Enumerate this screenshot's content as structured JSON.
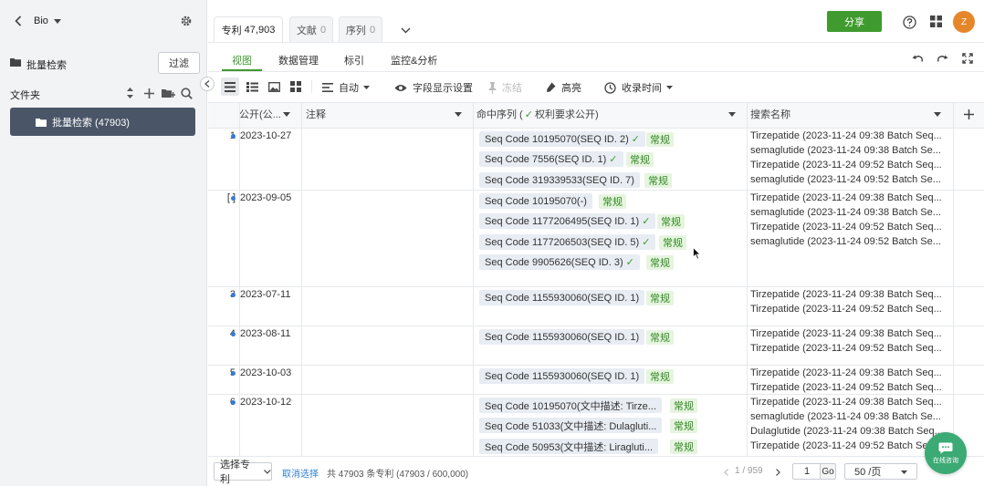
{
  "sidebar": {
    "title": "Bio",
    "search_label": "批量检索",
    "filter_button": "过滤",
    "folder_label": "文件夹",
    "folder_item": "批量检索 (47903)"
  },
  "tabs": [
    {
      "label": "专利",
      "count": "47,903"
    },
    {
      "label": "文献",
      "count": "0"
    },
    {
      "label": "序列",
      "count": "0"
    }
  ],
  "header": {
    "share": "分享",
    "avatar": "Z"
  },
  "subtabs": [
    "视图",
    "数据管理",
    "标引",
    "监控&分析"
  ],
  "toolbar": {
    "auto": "自动",
    "fields": "字段显示设置",
    "freeze": "冻结",
    "highlight": "高亮",
    "collect_time": "收录时间"
  },
  "columns": {
    "pub": "公开(公...",
    "note": "注释",
    "hits": "命中序列 (",
    "hits_tail": " 权利要求公开)",
    "search": "搜索名称"
  },
  "rows": [
    {
      "num": "1",
      "date": "2023-10-27"
    },
    {
      "num": "[ ]",
      "date": "2023-09-05"
    },
    {
      "num": "3",
      "date": "2023-07-11"
    },
    {
      "num": "4",
      "date": "2023-08-11"
    },
    {
      "num": "5",
      "date": "2023-10-03"
    },
    {
      "num": "6",
      "date": "2023-10-12"
    }
  ],
  "seqs": [
    {
      "text": "Seq Code 10195070(SEQ ID. 2)",
      "check": "✓",
      "badge": "常规"
    },
    {
      "text": "Seq Code 7556(SEQ ID. 1)",
      "check": "✓",
      "badge": "常规"
    },
    {
      "text": "Seq Code 319339533(SEQ ID. 7)",
      "check": "",
      "badge": "常规"
    },
    {
      "text": "Seq Code 10195070(-)",
      "check": "",
      "badge": "常规"
    },
    {
      "text": "Seq Code 1177206495(SEQ ID. 1)",
      "check": "✓",
      "badge": "常规"
    },
    {
      "text": "Seq Code 1177206503(SEQ ID. 5)",
      "check": "✓",
      "badge": "常规"
    },
    {
      "text": "Seq Code 9905626(SEQ ID. 3)",
      "check": "✓",
      "badge": "常规"
    },
    {
      "text": "Seq Code 1155930060(SEQ ID. 1)",
      "check": "",
      "badge": "常规"
    },
    {
      "text": "Seq Code 1155930060(SEQ ID. 1)",
      "check": "",
      "badge": "常规"
    },
    {
      "text": "Seq Code 1155930060(SEQ ID. 1)",
      "check": "",
      "badge": "常规"
    },
    {
      "text": "Seq Code 10195070(文中描述: Tirze...",
      "check": "",
      "badge": "常规"
    },
    {
      "text": "Seq Code 51033(文中描述: Dulagluti...",
      "check": "",
      "badge": "常规"
    },
    {
      "text": "Seq Code 50953(文中描述: Liraglutі...",
      "check": "",
      "badge": "常规"
    }
  ],
  "searches": [
    "Tirzepatide (2023-11-24 09:38 Batch Seq...",
    "semaglutide (2023-11-24 09:38 Batch Se...",
    "Tirzepatide (2023-11-24 09:52 Batch Seq...",
    "semaglutide (2023-11-24 09:52 Batch Se...",
    "Tirzepatide (2023-11-24 09:38 Batch Seq...",
    "semaglutide (2023-11-24 09:38 Batch Se...",
    "Tirzepatide (2023-11-24 09:52 Batch Seq...",
    "semaglutide (2023-11-24 09:52 Batch Se...",
    "Tirzepatide (2023-11-24 09:38 Batch Seq...",
    "Tirzepatide (2023-11-24 09:52 Batch Seq...",
    "Tirzepatide (2023-11-24 09:38 Batch Seq...",
    "Tirzepatide (2023-11-24 09:52 Batch Seq...",
    "Tirzepatide (2023-11-24 09:38 Batch Seq...",
    "Tirzepatide (2023-11-24 09:52 Batch Seq...",
    "Tirzepatide (2023-11-24 09:38 Batch Seq...",
    "semaglutide (2023-11-24 09:38 Batch Se...",
    "Dulaglutide (2023-11-24 09:38 Batch Seq...",
    "Tirzepatide (2023-11-24 09:52 Batch Seq..."
  ],
  "footer": {
    "select": "选择专利",
    "cancel": "取消选择",
    "total": "共 47903 条专利 (47903 / 600,000)",
    "pages": "1 / 959",
    "page_input": "1",
    "go": "Go",
    "page_size": "50 /页"
  },
  "chat": "在线咨询",
  "colors": {
    "accent": "#3f9b2e",
    "sidebar_item": "#4a5668",
    "dot": "#3a7bd5"
  }
}
